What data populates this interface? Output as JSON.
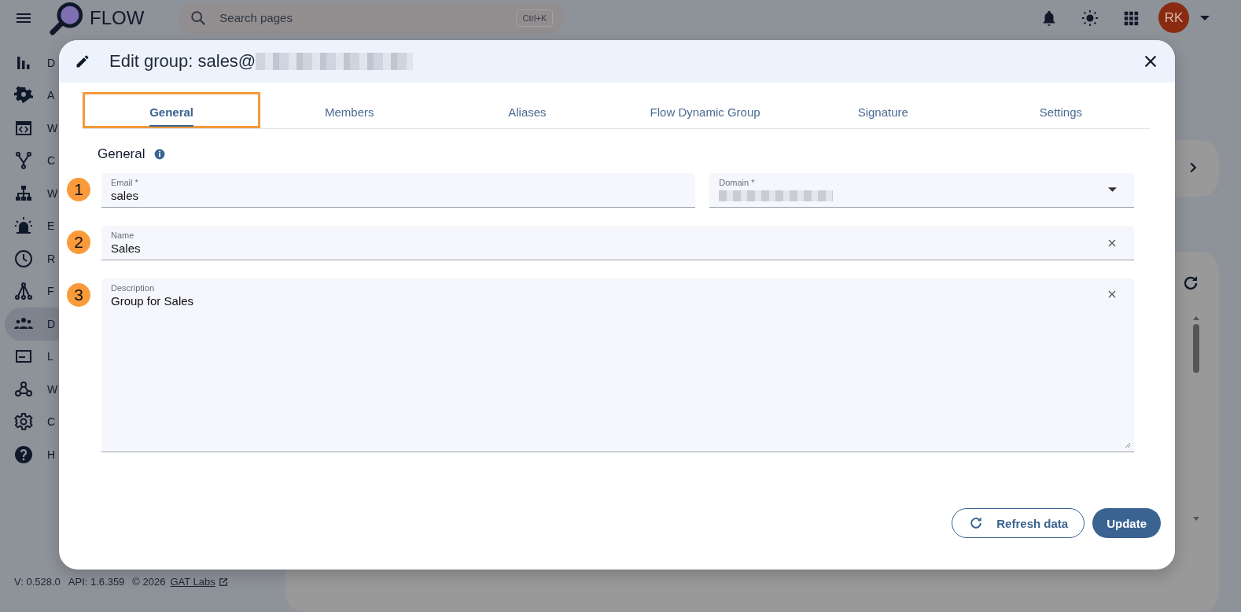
{
  "topbar": {
    "app_name": "FLOW",
    "search": {
      "placeholder": "Search pages",
      "shortcut": "Ctrl+K"
    },
    "avatar": "RK"
  },
  "sidebar": {
    "items": [
      {
        "label": "D",
        "selected": false
      },
      {
        "label": "A",
        "selected": false
      },
      {
        "label": "W",
        "selected": false
      },
      {
        "label": "C",
        "selected": false
      },
      {
        "label": "W",
        "selected": false
      },
      {
        "label": "E",
        "selected": false
      },
      {
        "label": "R",
        "selected": false
      },
      {
        "label": "F",
        "selected": false
      },
      {
        "label": "D",
        "selected": true
      },
      {
        "label": "L",
        "selected": false
      },
      {
        "label": "W",
        "selected": false
      },
      {
        "label": "C",
        "selected": false
      },
      {
        "label": "H",
        "selected": false
      }
    ]
  },
  "footer": {
    "version": "V: 0.528.0",
    "api": "API: 1.6.359",
    "copyright": "© 2026",
    "link": "GAT Labs"
  },
  "dialog": {
    "title": "Edit group: sales@",
    "tabs": [
      {
        "label": "General",
        "selected": true,
        "highlighted": true
      },
      {
        "label": "Members",
        "selected": false,
        "highlighted": false
      },
      {
        "label": "Aliases",
        "selected": false,
        "highlighted": false
      },
      {
        "label": "Flow Dynamic Group",
        "selected": false,
        "highlighted": false
      },
      {
        "label": "Signature",
        "selected": false,
        "highlighted": false
      },
      {
        "label": "Settings",
        "selected": false,
        "highlighted": false
      }
    ],
    "section_title": "General",
    "rows": [
      {
        "marker": "1",
        "fields": [
          {
            "kind": "text",
            "label": "Email *",
            "value": "sales"
          },
          {
            "kind": "select",
            "label": "Domain *"
          }
        ]
      },
      {
        "marker": "2",
        "fields": [
          {
            "kind": "clearable",
            "label": "Name",
            "value": "Sales"
          }
        ]
      },
      {
        "marker": "3",
        "fields": [
          {
            "kind": "textarea",
            "label": "Description",
            "value": "Group for Sales"
          }
        ]
      }
    ],
    "buttons": [
      {
        "kind": "outlined",
        "label": "Refresh data"
      },
      {
        "kind": "filled",
        "label": "Update"
      }
    ]
  }
}
